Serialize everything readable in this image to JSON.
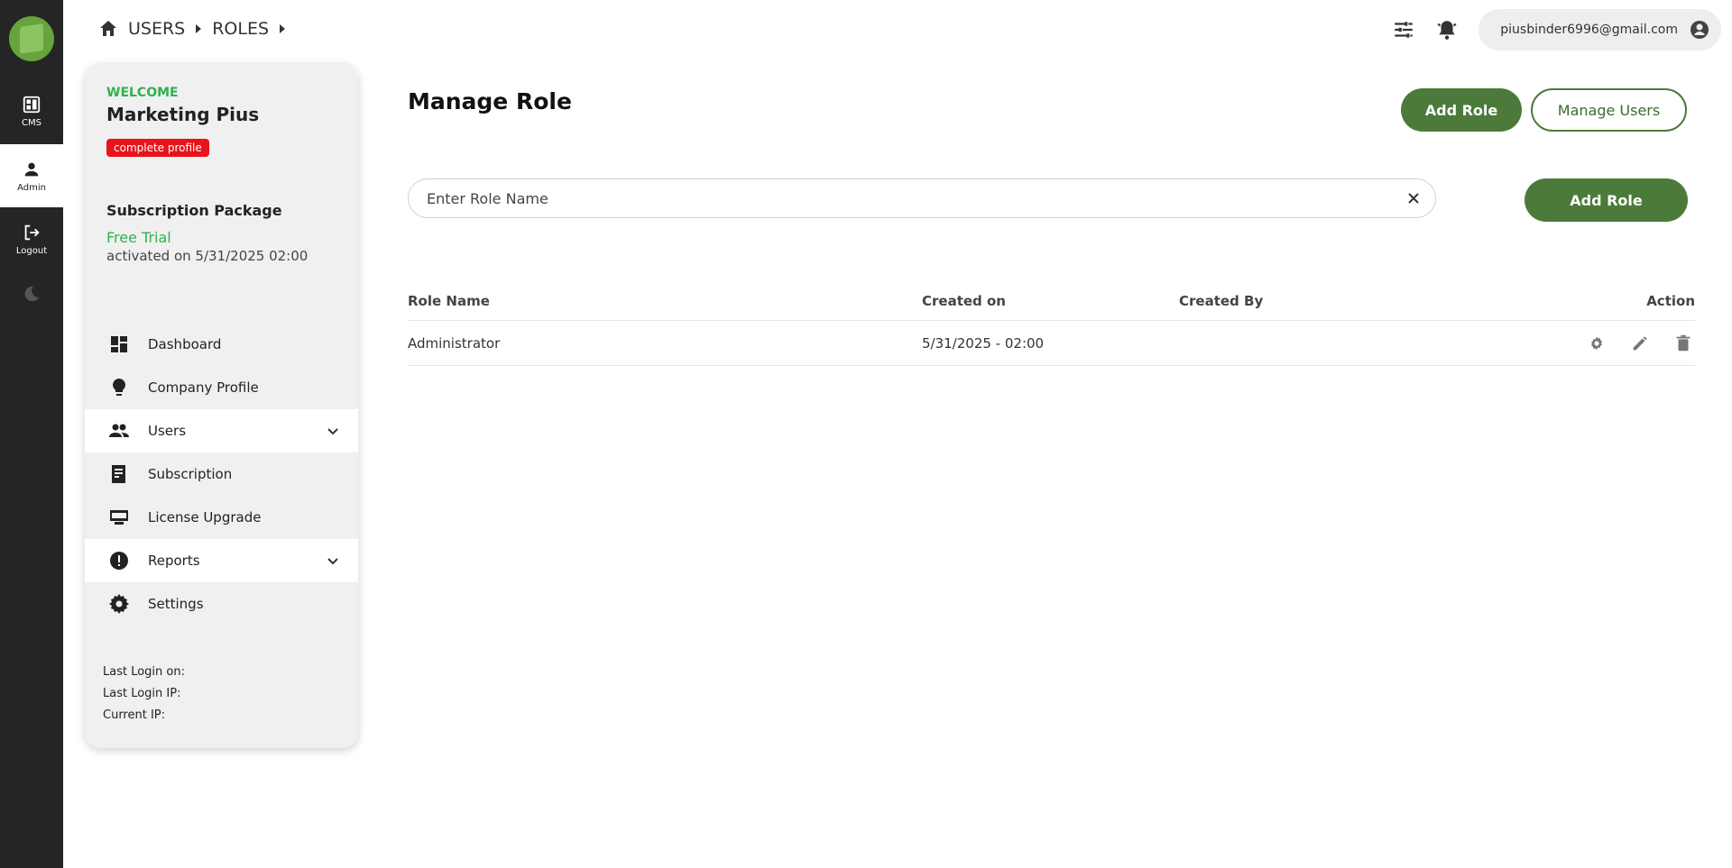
{
  "rail": {
    "items": [
      {
        "label": "CMS",
        "icon": "cms-icon"
      },
      {
        "label": "Admin",
        "icon": "person-icon"
      },
      {
        "label": "Logout",
        "icon": "logout-icon"
      }
    ]
  },
  "breadcrumb": {
    "items": [
      "USERS",
      "ROLES"
    ]
  },
  "header": {
    "email": "piusbinder6996@gmail.com"
  },
  "sidebar": {
    "welcome": "WELCOME",
    "user_name": "Marketing Pius",
    "badge": "complete profile",
    "subscription_title": "Subscription Package",
    "subscription_plan": "Free Trial",
    "subscription_activated": "activated on 5/31/2025 02:00",
    "menu": [
      {
        "label": "Dashboard",
        "icon": "dashboard-icon"
      },
      {
        "label": "Company Profile",
        "icon": "lightbulb-icon"
      },
      {
        "label": "Users",
        "icon": "people-icon"
      },
      {
        "label": "Subscription",
        "icon": "receipt-icon"
      },
      {
        "label": "License Upgrade",
        "icon": "card-icon"
      },
      {
        "label": "Reports",
        "icon": "alert-icon"
      },
      {
        "label": "Settings",
        "icon": "gear-icon"
      }
    ],
    "last_login_on": "Last Login on:",
    "last_login_ip": "Last Login IP:",
    "current_ip": "Current IP:"
  },
  "main": {
    "title": "Manage Role",
    "add_role_label": "Add Role",
    "manage_users_label": "Manage Users",
    "search_placeholder": "Enter Role Name",
    "search_value": "",
    "add_role_label_2": "Add Role",
    "table": {
      "headers": [
        "Role Name",
        "Created on",
        "Created By",
        "Action"
      ],
      "rows": [
        {
          "role_name": "Administrator",
          "created_on": "5/31/2025 - 02:00",
          "created_by": ""
        }
      ]
    }
  },
  "colors": {
    "rail": "#232624",
    "accent_green": "#4b7a3a",
    "welcome_green": "#2fb14c",
    "badge_red": "#e8131b"
  }
}
